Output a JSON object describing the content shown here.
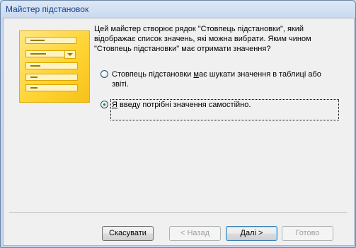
{
  "window": {
    "title": "Майстер підстановок"
  },
  "description": "Цей майстер створює рядок \"Стовпець підстановки\", який відображає список значень, які можна вибрати.  Яким чином \"Стовпець підстановки\" має отримати значення?",
  "options": [
    {
      "before": "Стовпець підстановки ",
      "accel": "м",
      "after": "ає шукати значення в таблиці або звіті.",
      "checked": false
    },
    {
      "before": "",
      "accel": "Я",
      "after": " введу потрібні значення самостійно.",
      "checked": true
    }
  ],
  "buttons": {
    "cancel": "Скасувати",
    "back": "< Назад",
    "next_accel": "Д",
    "next_rest": "алі >",
    "finish": "Готово"
  },
  "colors": {
    "title_text": "#15428b",
    "illustration": "#ffd22e"
  }
}
